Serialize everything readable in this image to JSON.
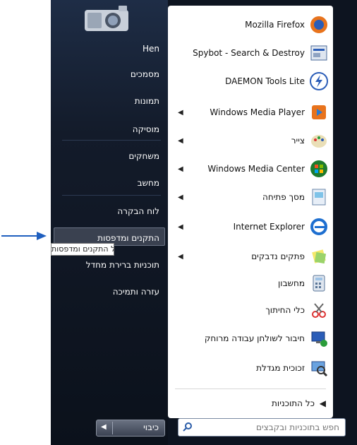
{
  "right_pane": {
    "user": "Hen",
    "links": [
      "מסמכים",
      "תמונות",
      "מוסיקה",
      "משחקים",
      "מחשב",
      "לוח הבקרה",
      "התקנים ומדפסות",
      "תוכניות ברירת מחדל",
      "עזרה ותמיכה"
    ],
    "tooltip": "הצג ונהל התקנים ומדפסות",
    "shutdown_label": "כיבוי"
  },
  "programs": [
    {
      "label": "Mozilla Firefox",
      "icon": "firefox-icon",
      "submenu": false
    },
    {
      "label": "Spybot - Search & Destroy",
      "icon": "spybot-icon",
      "submenu": false
    },
    {
      "label": "DAEMON Tools Lite",
      "icon": "daemon-tools-icon",
      "submenu": false
    },
    {
      "label": "Windows Media Player",
      "icon": "media-player-icon",
      "submenu": true
    },
    {
      "label": "צייר",
      "icon": "paint-icon",
      "submenu": true
    },
    {
      "label": "Windows Media Center",
      "icon": "media-center-icon",
      "submenu": true
    },
    {
      "label": "מסך פתיחה",
      "icon": "getting-started-icon",
      "submenu": true
    },
    {
      "label": "Internet Explorer",
      "icon": "internet-explorer-icon",
      "submenu": true
    },
    {
      "label": "פתקים נדבקים",
      "icon": "sticky-notes-icon",
      "submenu": true
    },
    {
      "label": "מחשבון",
      "icon": "calculator-icon",
      "submenu": false
    },
    {
      "label": "כלי החיתוך",
      "icon": "snipping-tool-icon",
      "submenu": false
    },
    {
      "label": "חיבור לשולחן עבודה מרוחק",
      "icon": "remote-desktop-icon",
      "submenu": false
    },
    {
      "label": "זכוכית מגדלת",
      "icon": "magnifier-icon",
      "submenu": false
    }
  ],
  "all_programs": "כל התוכניות",
  "search": {
    "placeholder": "חפש בתוכניות ובקבצים"
  }
}
